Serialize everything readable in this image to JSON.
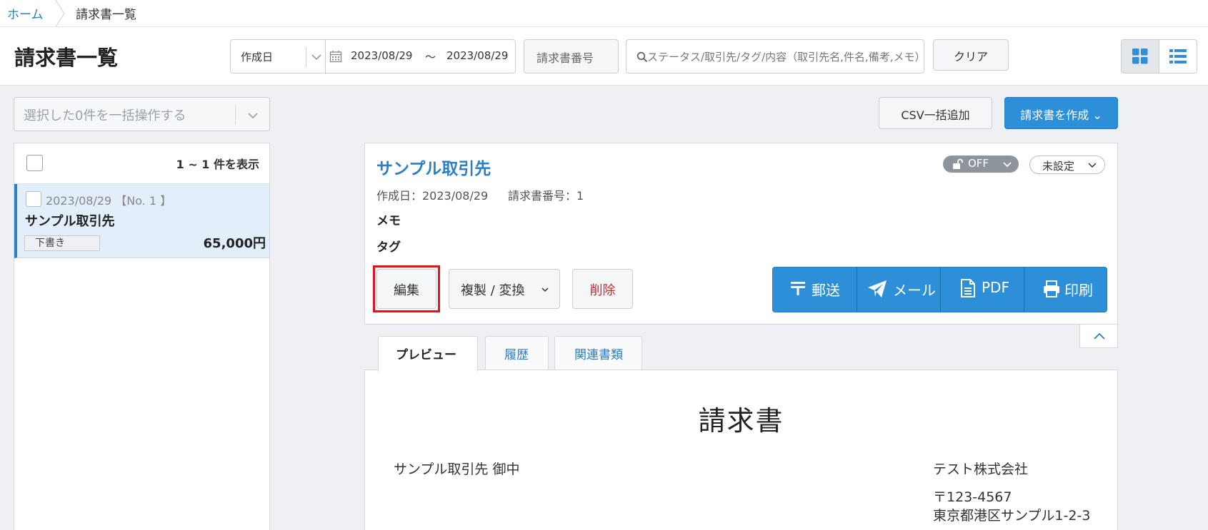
{
  "breadcrumb": {
    "home": "ホーム",
    "current": "請求書一覧"
  },
  "header": {
    "title": "請求書一覧",
    "date_type": "作成日",
    "date_from": "2023/08/29",
    "date_tilde": "～",
    "date_to": "2023/08/29",
    "invoice_no_placeholder": "請求書番号",
    "search_placeholder": "ステータス/取引先/タグ/内容（取引先名,件名,備考,メモ）",
    "clear_label": "クリア"
  },
  "left": {
    "bulk_action": "選択した0件を一括操作する",
    "count_text": "1 ~ 1 件を表示",
    "items": [
      {
        "date": "2023/08/29 【No. 1 】",
        "client": "サンプル取引先",
        "status": "下書き",
        "amount": "65,000円"
      }
    ]
  },
  "actions": {
    "csv_label": "CSV一括追加",
    "create_label": "請求書を作成 ⌄"
  },
  "detail": {
    "client": "サンプル取引先",
    "lock": "OFF",
    "unset": "未設定",
    "created": "作成日：2023/08/29",
    "invoice_no": "請求書番号：1",
    "memo_label": "メモ",
    "tag_label": "タグ",
    "edit_label": "編集",
    "copy_label": "複製 / 変換",
    "delete_label": "削除",
    "mail_post": "郵送",
    "email": "メール",
    "pdf": "PDF",
    "print": "印刷"
  },
  "tabs": [
    {
      "label": "プレビュー"
    },
    {
      "label": "履歴"
    },
    {
      "label": "関連書類"
    }
  ],
  "preview": {
    "title": "請求書",
    "client": "サンプル取引先 御中",
    "company": "テスト株式会社",
    "zip": "〒123-4567",
    "address": "東京都港区サンプル1-2-3"
  },
  "colors": {
    "accent": "#2d8fd8",
    "link": "#2a7fc6",
    "danger": "#d0262e",
    "highlight": "#e8111a"
  }
}
